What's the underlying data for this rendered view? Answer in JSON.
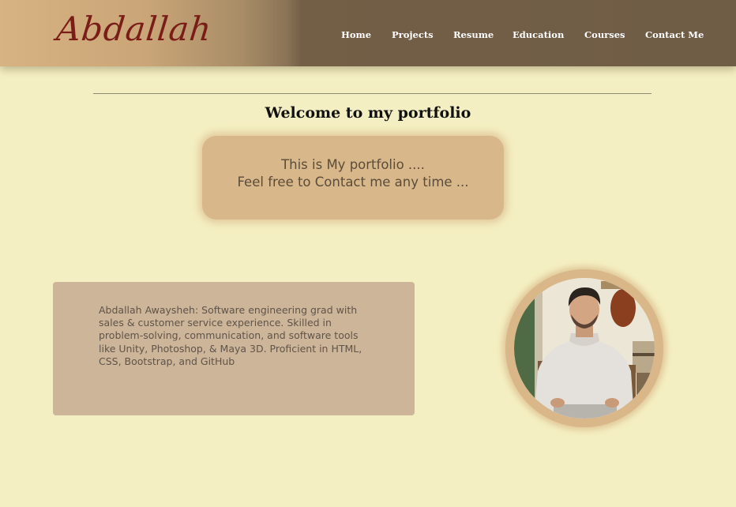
{
  "header": {
    "logo": "Abdallah",
    "nav": [
      {
        "label": "Home"
      },
      {
        "label": "Projects"
      },
      {
        "label": "Resume"
      },
      {
        "label": "Education"
      },
      {
        "label": "Courses"
      },
      {
        "label": "Contact Me"
      }
    ]
  },
  "main": {
    "welcome_title": "Welcome to my portfolio",
    "intro_lines": [
      "This is My portfolio ....",
      "Feel free to Contact me any time ..."
    ],
    "bio": "Abdallah Awaysheh: Software engineering grad with sales & customer service experience. Skilled in problem-solving, communication, and software tools like Unity, Photoshop, & Maya 3D. Proficient in HTML, CSS, Bootstrap, and GitHub"
  },
  "colors": {
    "page_background": "#f4efc2",
    "header_dark": "#705d45",
    "header_light": "#d7b383",
    "logo": "#7a1c17",
    "intro_box": "#d8b78a",
    "bio_card": "#cdb59a",
    "avatar_ring": "#d9b788"
  }
}
